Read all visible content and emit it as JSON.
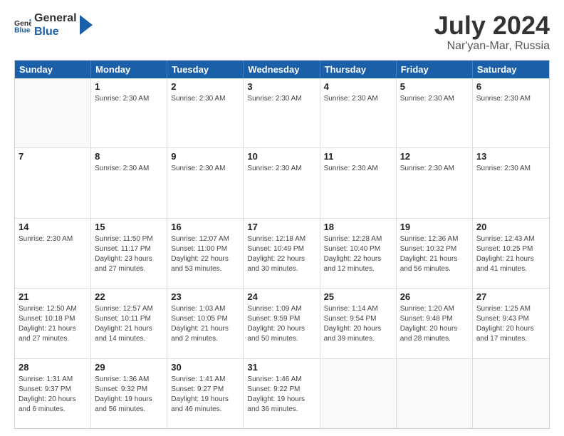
{
  "header": {
    "logo_general": "General",
    "logo_blue": "Blue",
    "month": "July 2024",
    "location": "Nar'yan-Mar, Russia"
  },
  "weekdays": [
    "Sunday",
    "Monday",
    "Tuesday",
    "Wednesday",
    "Thursday",
    "Friday",
    "Saturday"
  ],
  "weeks": [
    [
      {
        "day": "",
        "info": []
      },
      {
        "day": "1",
        "info": [
          "Sunrise: 2:30 AM"
        ]
      },
      {
        "day": "2",
        "info": [
          "Sunrise: 2:30 AM"
        ]
      },
      {
        "day": "3",
        "info": [
          "Sunrise: 2:30 AM"
        ]
      },
      {
        "day": "4",
        "info": [
          "Sunrise: 2:30 AM"
        ]
      },
      {
        "day": "5",
        "info": [
          "Sunrise: 2:30 AM"
        ]
      },
      {
        "day": "6",
        "info": [
          "Sunrise: 2:30 AM"
        ]
      }
    ],
    [
      {
        "day": "7",
        "info": []
      },
      {
        "day": "8",
        "info": [
          "Sunrise: 2:30 AM"
        ]
      },
      {
        "day": "9",
        "info": [
          "Sunrise: 2:30 AM"
        ]
      },
      {
        "day": "10",
        "info": [
          "Sunrise: 2:30 AM"
        ]
      },
      {
        "day": "11",
        "info": [
          "Sunrise: 2:30 AM"
        ]
      },
      {
        "day": "12",
        "info": [
          "Sunrise: 2:30 AM"
        ]
      },
      {
        "day": "13",
        "info": [
          "Sunrise: 2:30 AM"
        ]
      }
    ],
    [
      {
        "day": "14",
        "info": [
          "Sunrise: 2:30 AM"
        ]
      },
      {
        "day": "15",
        "info": [
          "Sunrise: 11:50 PM",
          "Sunset: 11:17 PM",
          "Daylight: 23 hours and 27 minutes."
        ]
      },
      {
        "day": "16",
        "info": [
          "Sunrise: 12:07 AM",
          "Sunset: 11:00 PM",
          "Daylight: 22 hours and 53 minutes."
        ]
      },
      {
        "day": "17",
        "info": [
          "Sunrise: 12:18 AM",
          "Sunset: 10:49 PM",
          "Daylight: 22 hours and 30 minutes."
        ]
      },
      {
        "day": "18",
        "info": [
          "Sunrise: 12:28 AM",
          "Sunset: 10:40 PM",
          "Daylight: 22 hours and 12 minutes."
        ]
      },
      {
        "day": "19",
        "info": [
          "Sunrise: 12:36 AM",
          "Sunset: 10:32 PM",
          "Daylight: 21 hours and 56 minutes."
        ]
      },
      {
        "day": "20",
        "info": [
          "Sunrise: 12:43 AM",
          "Sunset: 10:25 PM",
          "Daylight: 21 hours and 41 minutes."
        ]
      }
    ],
    [
      {
        "day": "21",
        "info": [
          "Sunrise: 12:50 AM",
          "Sunset: 10:18 PM",
          "Daylight: 21 hours and 27 minutes."
        ]
      },
      {
        "day": "22",
        "info": [
          "Sunrise: 12:57 AM",
          "Sunset: 10:11 PM",
          "Daylight: 21 hours and 14 minutes."
        ]
      },
      {
        "day": "23",
        "info": [
          "Sunrise: 1:03 AM",
          "Sunset: 10:05 PM",
          "Daylight: 21 hours and 2 minutes."
        ]
      },
      {
        "day": "24",
        "info": [
          "Sunrise: 1:09 AM",
          "Sunset: 9:59 PM",
          "Daylight: 20 hours and 50 minutes."
        ]
      },
      {
        "day": "25",
        "info": [
          "Sunrise: 1:14 AM",
          "Sunset: 9:54 PM",
          "Daylight: 20 hours and 39 minutes."
        ]
      },
      {
        "day": "26",
        "info": [
          "Sunrise: 1:20 AM",
          "Sunset: 9:48 PM",
          "Daylight: 20 hours and 28 minutes."
        ]
      },
      {
        "day": "27",
        "info": [
          "Sunrise: 1:25 AM",
          "Sunset: 9:43 PM",
          "Daylight: 20 hours and 17 minutes."
        ]
      }
    ],
    [
      {
        "day": "28",
        "info": [
          "Sunrise: 1:31 AM",
          "Sunset: 9:37 PM",
          "Daylight: 20 hours and 6 minutes."
        ]
      },
      {
        "day": "29",
        "info": [
          "Sunrise: 1:36 AM",
          "Sunset: 9:32 PM",
          "Daylight: 19 hours and 56 minutes."
        ]
      },
      {
        "day": "30",
        "info": [
          "Sunrise: 1:41 AM",
          "Sunset: 9:27 PM",
          "Daylight: 19 hours and 46 minutes."
        ]
      },
      {
        "day": "31",
        "info": [
          "Sunrise: 1:46 AM",
          "Sunset: 9:22 PM",
          "Daylight: 19 hours and 36 minutes."
        ]
      },
      {
        "day": "",
        "info": []
      },
      {
        "day": "",
        "info": []
      },
      {
        "day": "",
        "info": []
      }
    ]
  ]
}
